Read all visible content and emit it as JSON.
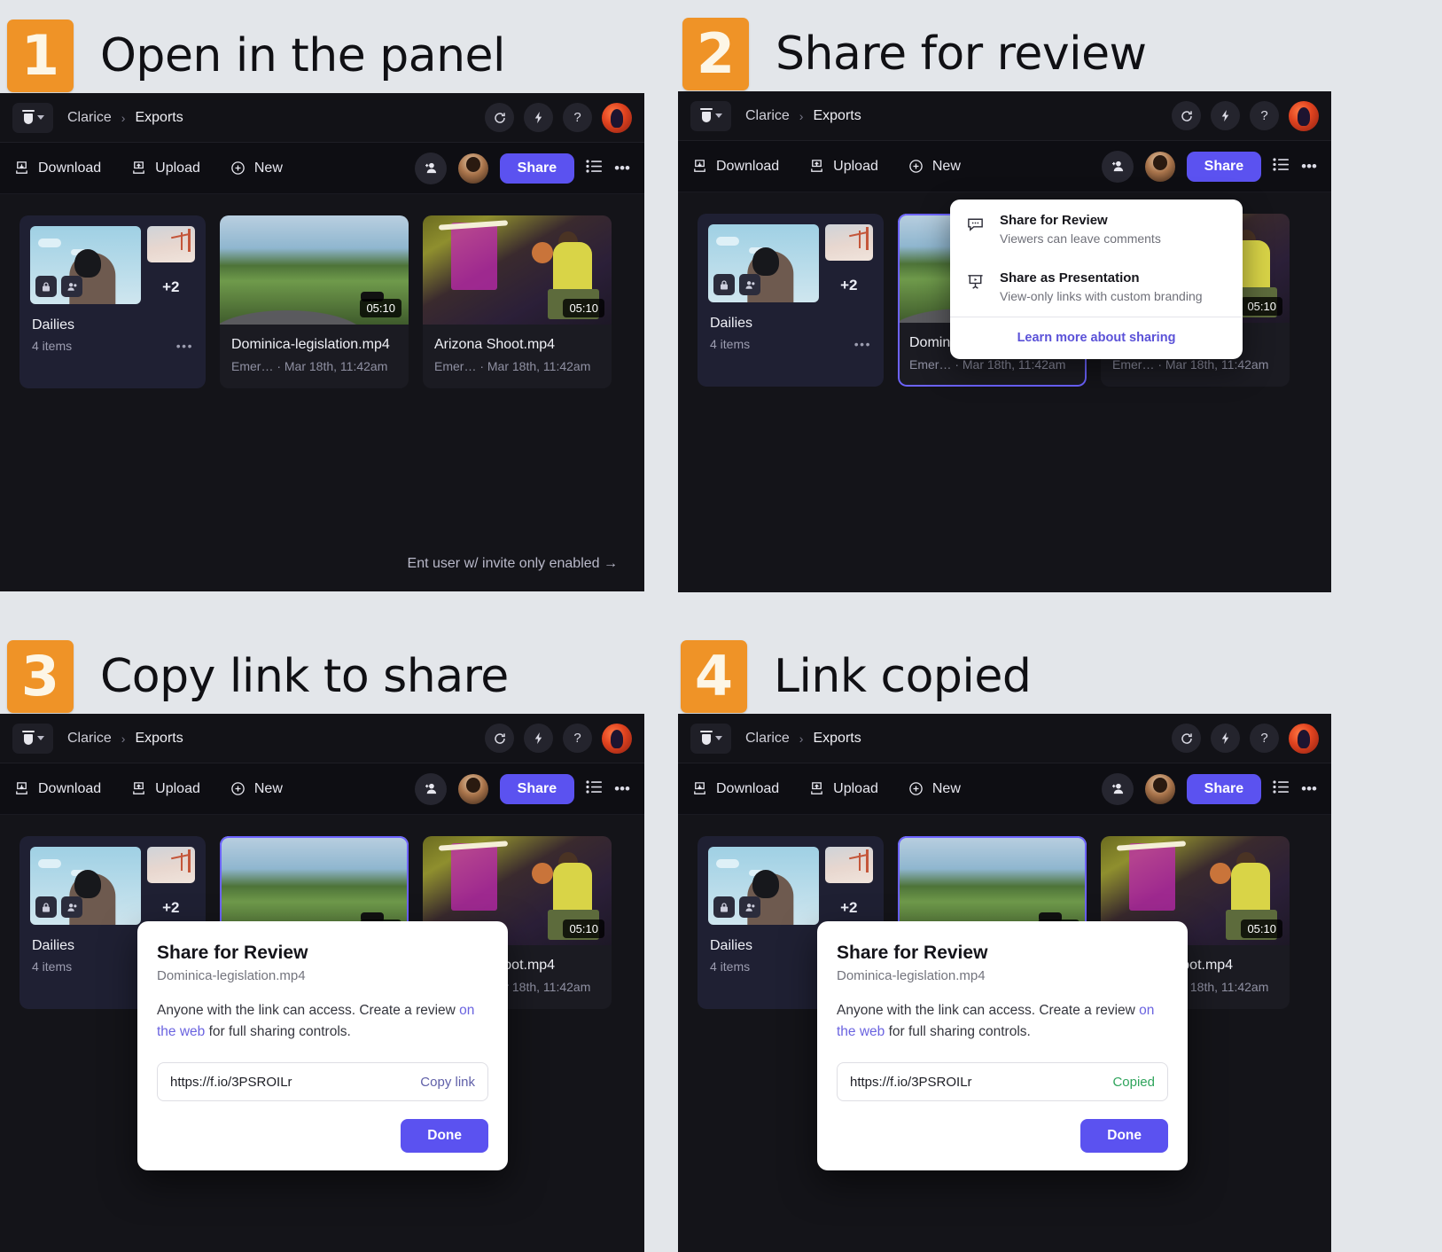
{
  "steps": [
    {
      "num": "1",
      "title": "Open in the panel"
    },
    {
      "num": "2",
      "title": "Share for review"
    },
    {
      "num": "3",
      "title": "Copy link to share"
    },
    {
      "num": "4",
      "title": "Link copied"
    }
  ],
  "app": {
    "breadcrumb": {
      "root": "Clarice",
      "separator": "›",
      "current": "Exports"
    },
    "titlebar_icons": [
      "refresh-icon",
      "lightning-icon",
      "help-icon",
      "user-avatar"
    ],
    "help_glyph": "?",
    "toolbar": {
      "download": "Download",
      "upload": "Upload",
      "new": "New",
      "share": "Share",
      "add_people_icon": "add-person-icon",
      "list_view_icon": "list-view-icon",
      "more_icon": "more-options-icon"
    },
    "cards": [
      {
        "type": "folder",
        "name": "Dailies",
        "sub": "4 items",
        "extra_badge": "+2",
        "more": "•••"
      },
      {
        "type": "video",
        "name": "Dominica-legislation.mp4",
        "sub": "Emer… · Mar 18th, 11:42am",
        "duration": "05:10"
      },
      {
        "type": "video",
        "name": "Arizona Shoot.mp4",
        "sub": "Emer… · Mar 18th, 11:42am",
        "duration": "05:10"
      }
    ],
    "hint": "Ent user w/ invite only enabled →"
  },
  "share_menu": {
    "items": [
      {
        "icon": "comment-bubble-icon",
        "title": "Share for Review",
        "subtitle": "Viewers can leave comments"
      },
      {
        "icon": "presentation-icon",
        "title": "Share as Presentation",
        "subtitle": "View-only links with custom branding"
      }
    ],
    "link": "Learn more about sharing"
  },
  "share_modal": {
    "title": "Share for Review",
    "filename": "Dominica-legislation.mp4",
    "body_before": "Anyone with the link can access. Create a review ",
    "body_link": "on the web",
    "body_after": " for full sharing controls.",
    "url": "https://f.io/3PSROILr",
    "action_copy": "Copy link",
    "action_copied": "Copied",
    "done": "Done"
  },
  "colors": {
    "accent": "#5b52f0",
    "badge": "#ef9327",
    "page_bg": "#e3e6ea",
    "app_bg": "#141419",
    "copied_green": "#2fa45c",
    "link_purple": "#6a63e0"
  }
}
